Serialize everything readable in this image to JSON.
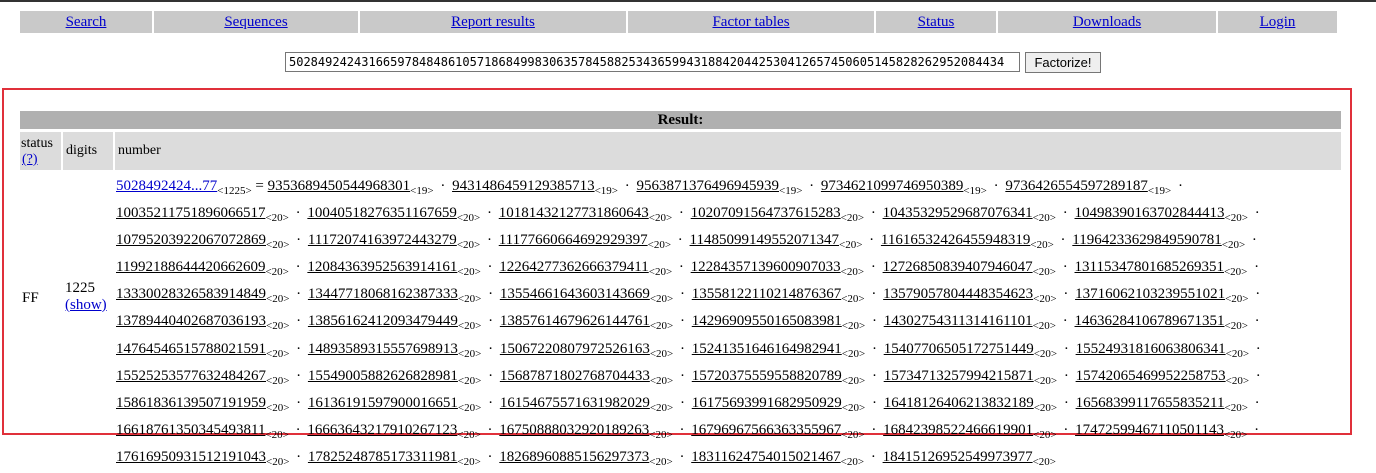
{
  "nav": [
    "Search",
    "Sequences",
    "Report results",
    "Factor tables",
    "Status",
    "Downloads",
    "Login"
  ],
  "search": {
    "value": "502849242431665978484861057186849983063578458825343659943188420442530412657450605145828262952084434",
    "button": "Factorize!"
  },
  "result": {
    "title": "Result:",
    "col_status": "status",
    "status_help": "(?)",
    "col_digits": "digits",
    "col_number": "number",
    "status": "FF",
    "digits": "1225",
    "show": "(show)",
    "number_short": "5028492424...77",
    "number_digits": "<1225>",
    "equals": "=",
    "factors": [
      {
        "v": "9353689450544968301",
        "d": "<19>"
      },
      {
        "v": "9431486459129385713",
        "d": "<19>"
      },
      {
        "v": "9563871376496945939",
        "d": "<19>"
      },
      {
        "v": "9734621099746950389",
        "d": "<19>"
      },
      {
        "v": "9736426554597289187",
        "d": "<19>"
      },
      {
        "v": "10035211751896066517",
        "d": "<20>"
      },
      {
        "v": "10040518276351167659",
        "d": "<20>"
      },
      {
        "v": "10181432127731860643",
        "d": "<20>"
      },
      {
        "v": "10207091564737615283",
        "d": "<20>"
      },
      {
        "v": "10435329529687076341",
        "d": "<20>"
      },
      {
        "v": "10498390163702844413",
        "d": "<20>"
      },
      {
        "v": "10795203922067072869",
        "d": "<20>"
      },
      {
        "v": "11172074163972443279",
        "d": "<20>"
      },
      {
        "v": "11177660664692929397",
        "d": "<20>"
      },
      {
        "v": "11485099149552071347",
        "d": "<20>"
      },
      {
        "v": "11616532426455948319",
        "d": "<20>"
      },
      {
        "v": "11964233629849590781",
        "d": "<20>"
      },
      {
        "v": "11992188644420662609",
        "d": "<20>"
      },
      {
        "v": "12084363952563914161",
        "d": "<20>"
      },
      {
        "v": "12264277362666379411",
        "d": "<20>"
      },
      {
        "v": "12284357139600907033",
        "d": "<20>"
      },
      {
        "v": "12726850839407946047",
        "d": "<20>"
      },
      {
        "v": "13115347801685269351",
        "d": "<20>"
      },
      {
        "v": "13330028326583914849",
        "d": "<20>"
      },
      {
        "v": "13447718068162387333",
        "d": "<20>"
      },
      {
        "v": "13554661643603143669",
        "d": "<20>"
      },
      {
        "v": "13558122110214876367",
        "d": "<20>"
      },
      {
        "v": "13579057804448354623",
        "d": "<20>"
      },
      {
        "v": "13716062103239551021",
        "d": "<20>"
      },
      {
        "v": "13789440402687036193",
        "d": "<20>"
      },
      {
        "v": "13856162412093479449",
        "d": "<20>"
      },
      {
        "v": "13857614679626144761",
        "d": "<20>"
      },
      {
        "v": "14296909550165083981",
        "d": "<20>"
      },
      {
        "v": "14302754311314161101",
        "d": "<20>"
      },
      {
        "v": "14636284106789671351",
        "d": "<20>"
      },
      {
        "v": "14764546515788021591",
        "d": "<20>"
      },
      {
        "v": "14893589315557698913",
        "d": "<20>"
      },
      {
        "v": "15067220807972526163",
        "d": "<20>"
      },
      {
        "v": "15241351646164982941",
        "d": "<20>"
      },
      {
        "v": "15407706505172751449",
        "d": "<20>"
      },
      {
        "v": "15524931816063806341",
        "d": "<20>"
      },
      {
        "v": "15525253577632484267",
        "d": "<20>"
      },
      {
        "v": "15549005882626828981",
        "d": "<20>"
      },
      {
        "v": "15687871802768704433",
        "d": "<20>"
      },
      {
        "v": "15720375559558820789",
        "d": "<20>"
      },
      {
        "v": "15734713257994215871",
        "d": "<20>"
      },
      {
        "v": "15742065469952258753",
        "d": "<20>"
      },
      {
        "v": "15861836139507191959",
        "d": "<20>"
      },
      {
        "v": "16136191597900016651",
        "d": "<20>"
      },
      {
        "v": "16154675571631982029",
        "d": "<20>"
      },
      {
        "v": "16175693991682950929",
        "d": "<20>"
      },
      {
        "v": "16418126406213832189",
        "d": "<20>"
      },
      {
        "v": "16568399117655835211",
        "d": "<20>"
      },
      {
        "v": "16618761350345493811",
        "d": "<20>"
      },
      {
        "v": "16663643217910267123",
        "d": "<20>"
      },
      {
        "v": "16750888032920189263",
        "d": "<20>"
      },
      {
        "v": "16796967566363355967",
        "d": "<20>"
      },
      {
        "v": "16842398522466619901",
        "d": "<20>"
      },
      {
        "v": "17472599467110501143",
        "d": "<20>"
      },
      {
        "v": "17616950931512191043",
        "d": "<20>"
      },
      {
        "v": "17825248785173311981",
        "d": "<20>"
      },
      {
        "v": "18268960885156297373",
        "d": "<20>"
      },
      {
        "v": "18311624754015021467",
        "d": "<20>"
      },
      {
        "v": "18415126952549973977",
        "d": "<20>"
      }
    ]
  }
}
